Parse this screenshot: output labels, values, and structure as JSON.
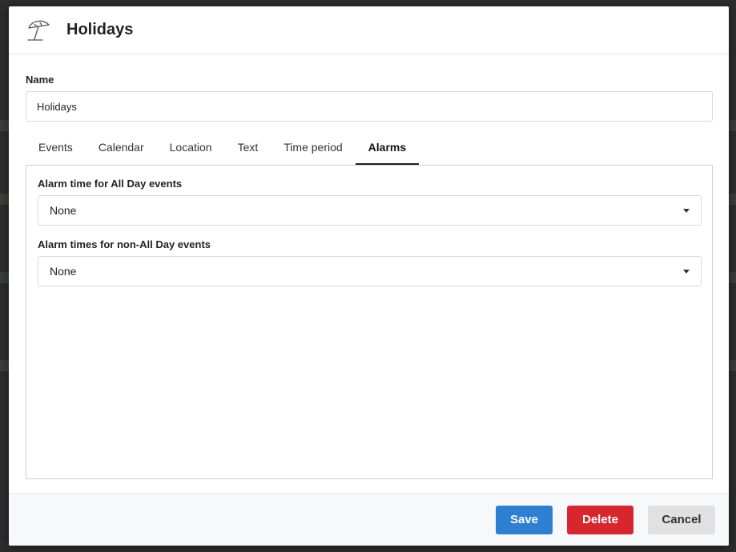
{
  "dialog": {
    "title": "Holidays",
    "icon": "beach-umbrella-icon"
  },
  "name_field": {
    "label": "Name",
    "value": "Holidays"
  },
  "tabs": [
    {
      "label": "Events",
      "active": false
    },
    {
      "label": "Calendar",
      "active": false
    },
    {
      "label": "Location",
      "active": false
    },
    {
      "label": "Text",
      "active": false
    },
    {
      "label": "Time period",
      "active": false
    },
    {
      "label": "Alarms",
      "active": true
    }
  ],
  "alarms": {
    "all_day_label": "Alarm time for All Day events",
    "all_day_value": "None",
    "non_all_day_label": "Alarm times for non-All Day events",
    "non_all_day_value": "None"
  },
  "footer": {
    "save_label": "Save",
    "delete_label": "Delete",
    "cancel_label": "Cancel"
  },
  "colors": {
    "save": "#2d7fd1",
    "delete": "#d7262e",
    "cancel": "#e1e1e1"
  }
}
